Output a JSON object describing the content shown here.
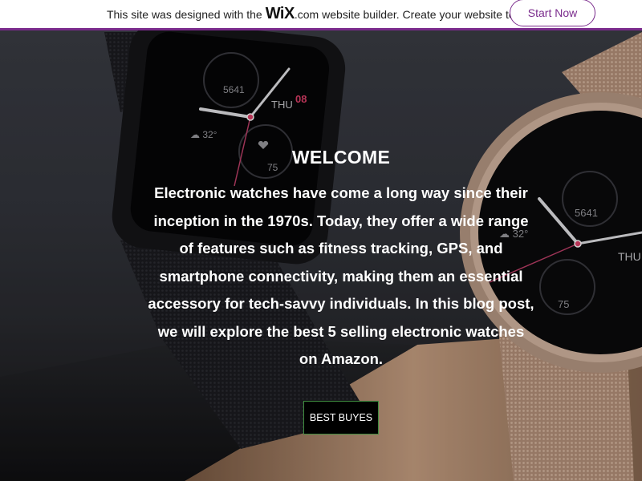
{
  "banner": {
    "prefix": "This site was designed with the",
    "logo": "WiX",
    "logo_domain": ".com",
    "suffix": "website builder. Create your website today.",
    "cta": "Start Now"
  },
  "hero": {
    "title": "WELCOME",
    "paragraph_lines": [
      "Electronic watches have come a long way since their",
      "inception in the 1970s. Today, they offer a wide range",
      "of features such as fitness tracking, GPS, and",
      "smartphone connectivity, making them an essential",
      "accessory for tech-savvy individuals. In this blog post,",
      "we will explore the best 5 selling electronic watches",
      "on Amazon."
    ],
    "button_label": "BEST BUYES"
  },
  "watch_left": {
    "steps": "5641",
    "day": "THU",
    "date": "08",
    "temp": "32°",
    "heart": "75"
  },
  "watch_right": {
    "steps": "5641",
    "day": "THU",
    "temp": "32°",
    "heart": "75"
  },
  "colors": {
    "banner_border": "#7a2b8c",
    "cta_text": "#7a2b8c",
    "button_border": "#3f8c3f",
    "date_accent": "#e0406a",
    "rose_gold": "#c9a48c"
  }
}
